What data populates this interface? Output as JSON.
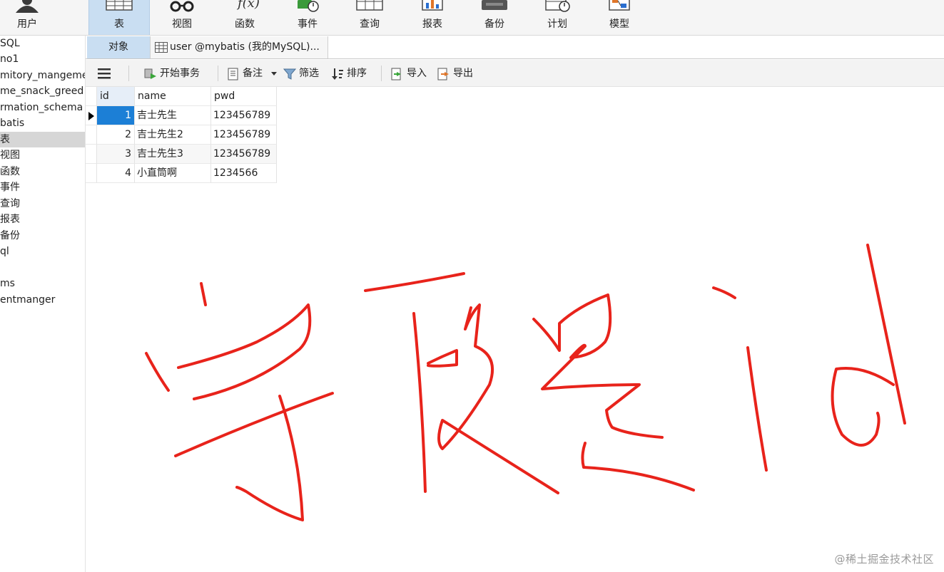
{
  "ribbon": {
    "items": [
      {
        "label": "用户",
        "icon": "user-icon"
      },
      {
        "label": "表",
        "icon": "table-icon"
      },
      {
        "label": "视图",
        "icon": "view-glasses-icon"
      },
      {
        "label": "函数",
        "icon": "function-icon"
      },
      {
        "label": "事件",
        "icon": "event-icon"
      },
      {
        "label": "查询",
        "icon": "query-icon"
      },
      {
        "label": "报表",
        "icon": "report-icon"
      },
      {
        "label": "备份",
        "icon": "backup-icon"
      },
      {
        "label": "计划",
        "icon": "schedule-icon"
      },
      {
        "label": "模型",
        "icon": "model-icon"
      }
    ],
    "active": "表"
  },
  "sidebar": {
    "items": [
      {
        "label": "SQL"
      },
      {
        "label": "no1"
      },
      {
        "label": "mitory_mangeme"
      },
      {
        "label": "me_snack_greed"
      },
      {
        "label": "rmation_schema"
      },
      {
        "label": "batis"
      },
      {
        "label": "表"
      },
      {
        "label": "视图"
      },
      {
        "label": "函数"
      },
      {
        "label": "事件"
      },
      {
        "label": "查询"
      },
      {
        "label": "报表"
      },
      {
        "label": "备份"
      },
      {
        "label": "ql"
      },
      {
        "label": ""
      },
      {
        "label": "ms"
      },
      {
        "label": "entmanger"
      }
    ],
    "selected": "表"
  },
  "tabs": {
    "objects_label": "对象",
    "table_tab_label": "user @mybatis (我的MySQL)..."
  },
  "subtoolbar": {
    "menu_icon": "hamburger-icon",
    "begin_transaction": "开始事务",
    "memo": "备注",
    "filter": "筛选",
    "sort": "排序",
    "import": "导入",
    "export": "导出"
  },
  "grid": {
    "columns": [
      "id",
      "name",
      "pwd"
    ],
    "rows": [
      {
        "id": "1",
        "name": "吉士先生",
        "pwd": "123456789"
      },
      {
        "id": "2",
        "name": "吉士先生2",
        "pwd": "123456789"
      },
      {
        "id": "3",
        "name": "吉士先生3",
        "pwd": "123456789"
      },
      {
        "id": "4",
        "name": "小直筒啊",
        "pwd": "1234566"
      }
    ],
    "current_row": 0
  },
  "annotation": {
    "color": "#e8231b"
  },
  "watermark": "@稀土掘金技术社区"
}
